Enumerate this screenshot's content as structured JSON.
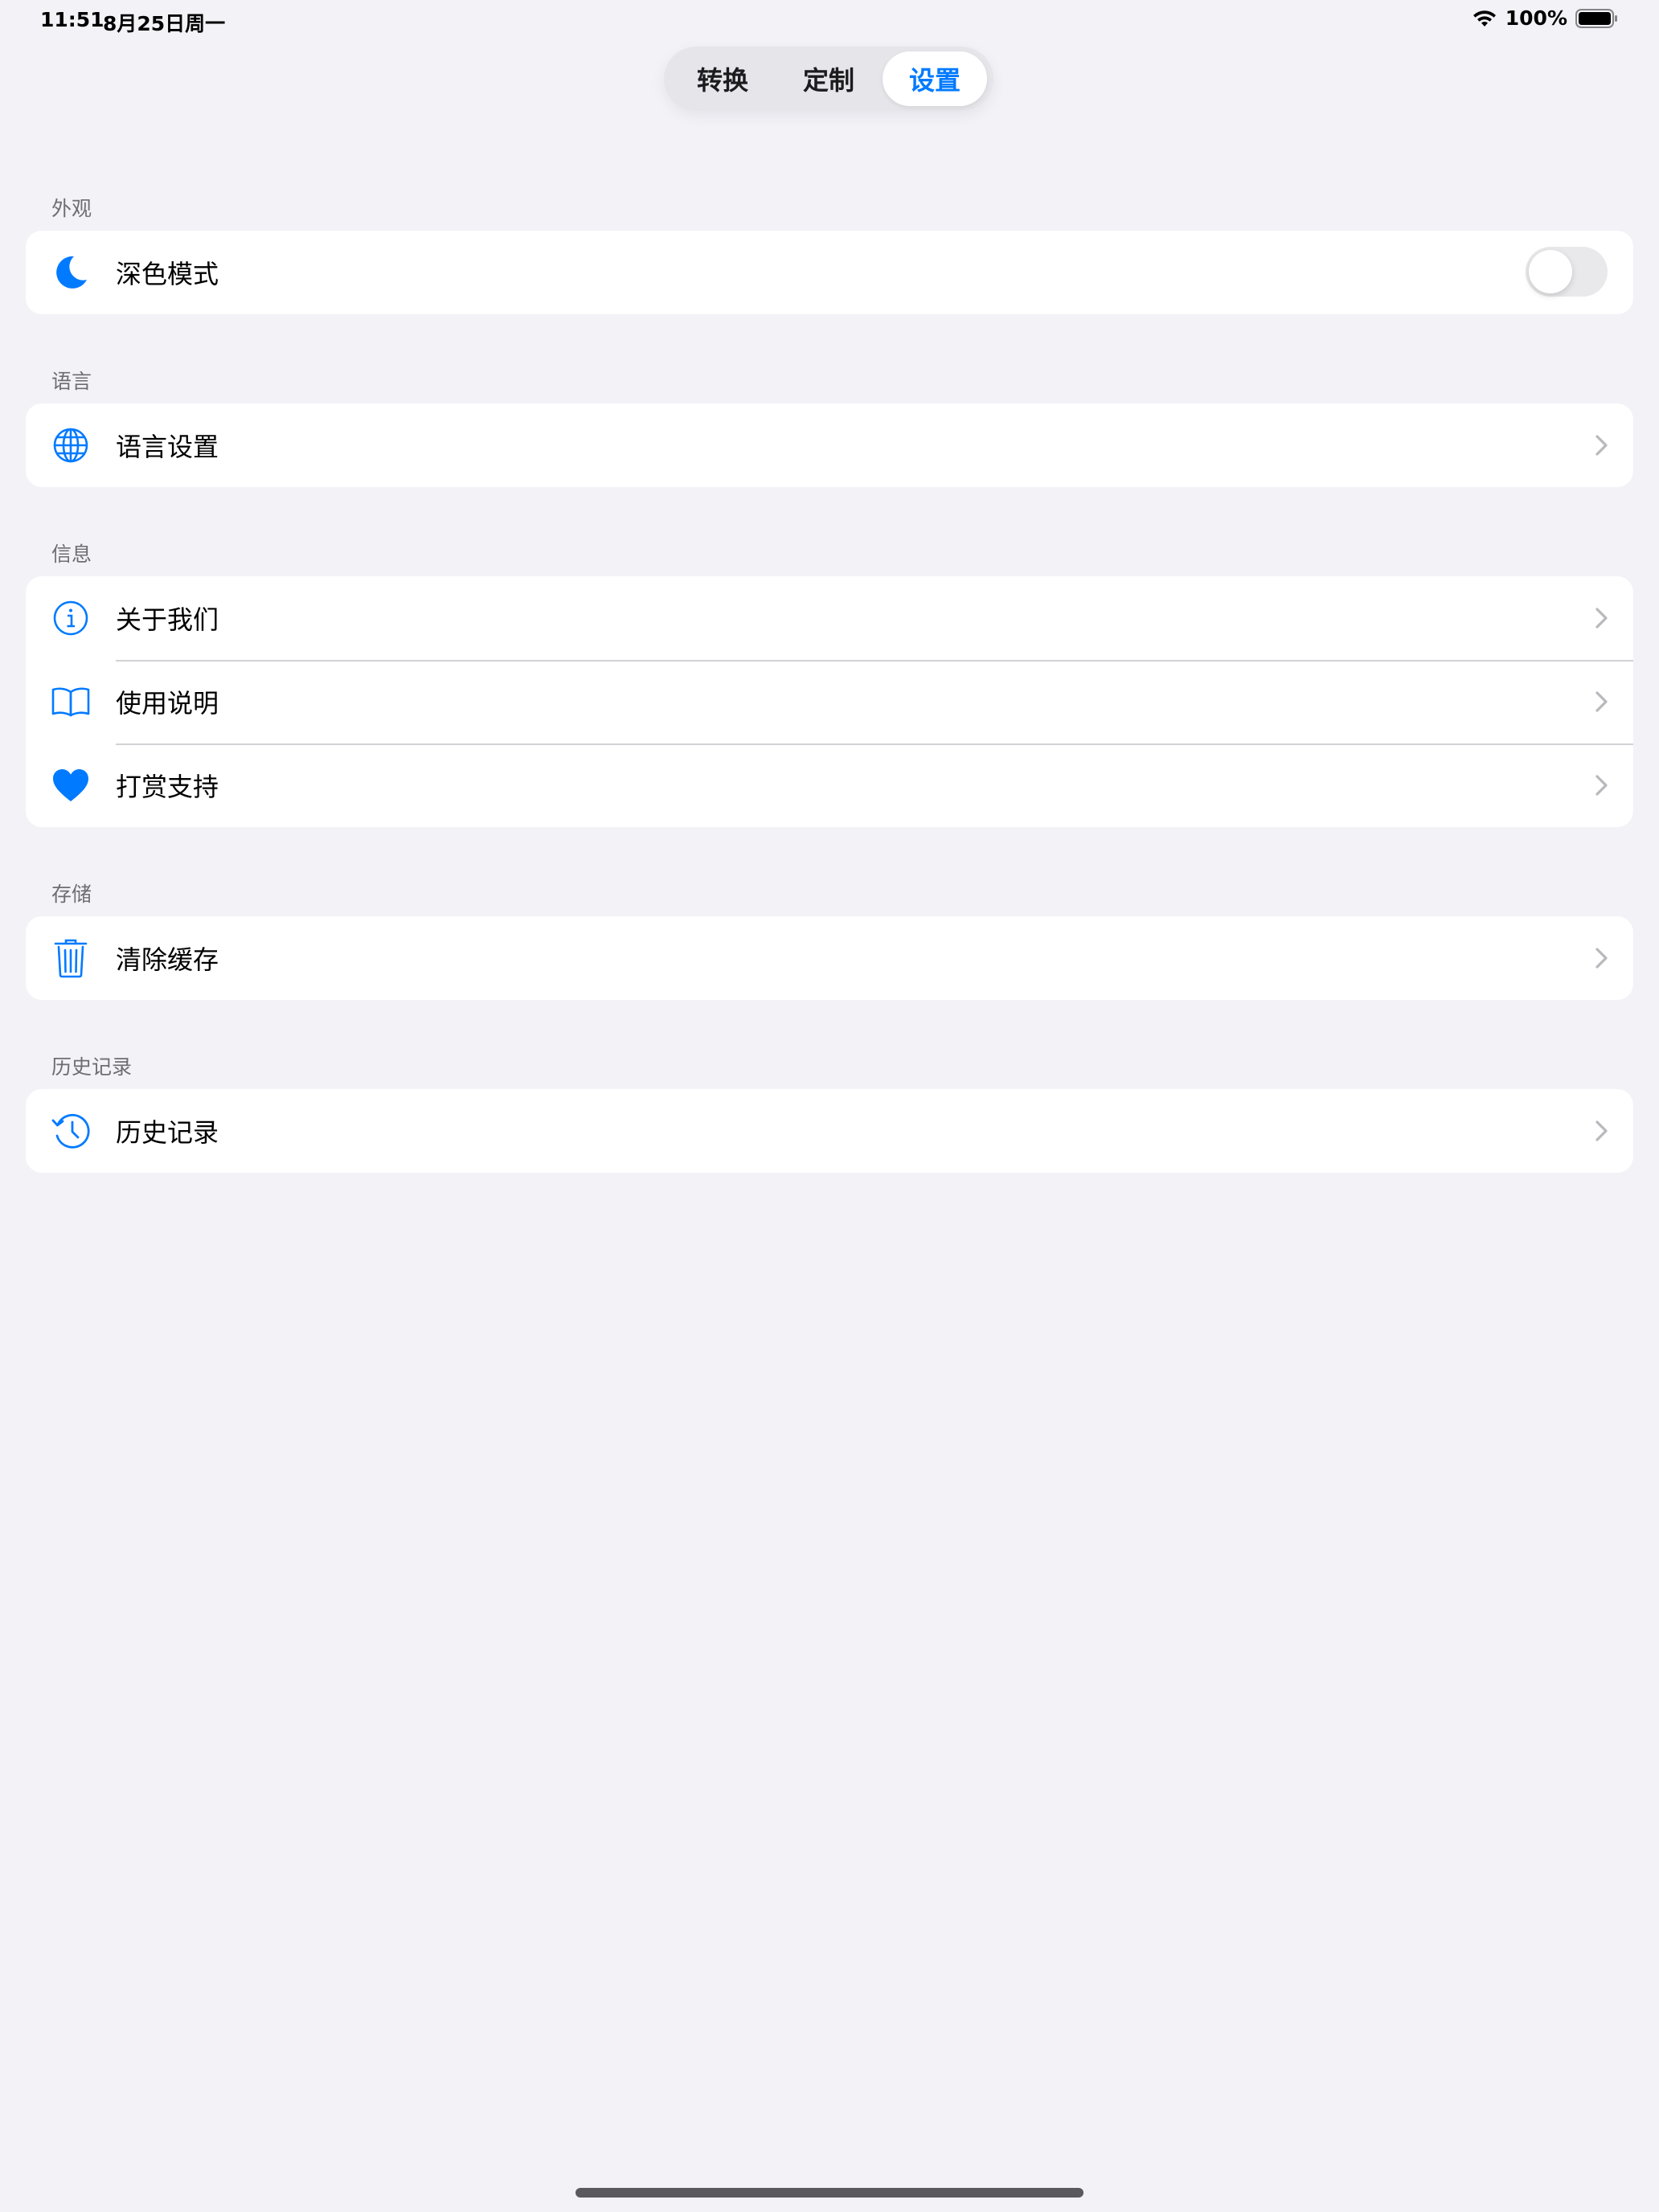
{
  "status_bar": {
    "time": "11:51",
    "date": "8月25日周一",
    "battery": "100%"
  },
  "segmented": {
    "items": [
      {
        "label": "转换"
      },
      {
        "label": "定制"
      },
      {
        "label": "设置"
      }
    ],
    "selected": "设置"
  },
  "sections": {
    "appearance": {
      "header": "外观",
      "dark_mode": {
        "label": "深色模式",
        "icon": "moon-icon",
        "toggle_on": false
      }
    },
    "language": {
      "header": "语言",
      "language_settings": {
        "label": "语言设置",
        "icon": "globe-icon"
      }
    },
    "info": {
      "header": "信息",
      "about": {
        "label": "关于我们",
        "icon": "info-icon"
      },
      "guide": {
        "label": "使用说明",
        "icon": "book-icon"
      },
      "tip": {
        "label": "打赏支持",
        "icon": "heart-icon"
      }
    },
    "storage": {
      "header": "存储",
      "clear_cache": {
        "label": "清除缓存",
        "icon": "trash-icon"
      }
    },
    "history": {
      "header": "历史记录",
      "history": {
        "label": "历史记录",
        "icon": "history-icon"
      }
    }
  },
  "colors": {
    "accent": "#007aff",
    "background": "#f2f2f7",
    "card": "#ffffff",
    "separator": "#d1d1d6",
    "secondary_text": "#6d6d72"
  }
}
